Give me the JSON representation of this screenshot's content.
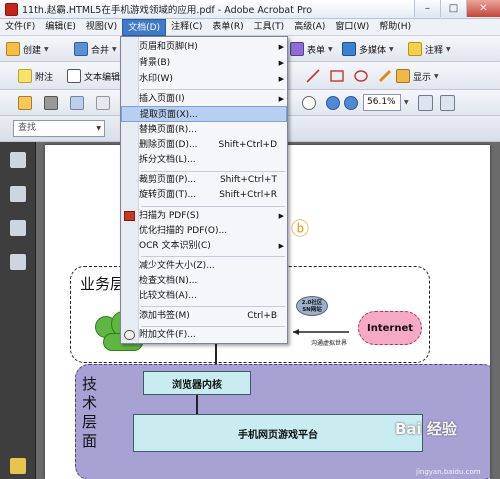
{
  "window": {
    "title": "11th.赵霸.HTML5在手机游戏领域的应用.pdf - Adobe Acrobat Pro",
    "minimize": "–",
    "maximize": "□",
    "close": "✕"
  },
  "menubar": [
    "文件(F)",
    "编辑(E)",
    "视图(V)",
    "文档(D)",
    "注释(C)",
    "表单(R)",
    "工具(T)",
    "高级(A)",
    "窗口(W)",
    "帮助(H)"
  ],
  "toolbar1": {
    "create": "创建",
    "combine": "合并",
    "forms": "表单",
    "multimedia": "多媒体",
    "comment": "注释"
  },
  "toolbar2": {
    "attach": "附注",
    "text_edit": "文本编辑",
    "display": "显示"
  },
  "toolbar3": {
    "zoom": "56.1%"
  },
  "toolbar4": {
    "find": "查找"
  },
  "document_menu": {
    "items": [
      {
        "label": "页眉和页脚(H)",
        "shortcut": "",
        "submenu": true
      },
      {
        "label": "背景(B)",
        "shortcut": "",
        "submenu": true
      },
      {
        "label": "水印(W)",
        "shortcut": "",
        "submenu": true
      },
      {
        "label": "插入页面(I)",
        "shortcut": "",
        "submenu": true
      },
      {
        "label": "提取页面(X)...",
        "shortcut": "",
        "submenu": false
      },
      {
        "label": "替换页面(R)...",
        "shortcut": "",
        "submenu": false
      },
      {
        "label": "删除页面(D)...",
        "shortcut": "Shift+Ctrl+D",
        "submenu": false
      },
      {
        "label": "拆分文档(L)...",
        "shortcut": "",
        "submenu": false
      },
      {
        "label": "裁剪页面(P)...",
        "shortcut": "Shift+Ctrl+T",
        "submenu": false
      },
      {
        "label": "旋转页面(T)...",
        "shortcut": "Shift+Ctrl+R",
        "submenu": false
      },
      {
        "label": "扫描为 PDF(S)",
        "shortcut": "",
        "submenu": true
      },
      {
        "label": "优化扫描的 PDF(O)...",
        "shortcut": "",
        "submenu": false
      },
      {
        "label": "OCR 文本识别(C)",
        "shortcut": "",
        "submenu": true
      },
      {
        "label": "减少文件大小(Z)...",
        "shortcut": "",
        "submenu": false
      },
      {
        "label": "检查文档(N)...",
        "shortcut": "",
        "submenu": false
      },
      {
        "label": "比较文档(A)...",
        "shortcut": "",
        "submenu": false
      },
      {
        "label": "添加书签(M)",
        "shortcut": "Ctrl+B",
        "submenu": false
      },
      {
        "label": "附加文件(F)...",
        "shortcut": "",
        "submenu": false
      }
    ]
  },
  "diagram": {
    "business_layer": "业务层",
    "tech_layer": "技术层面",
    "browser_core": "浏览器内核",
    "game_platform": "手机网页游戏平台",
    "internet": "Internet",
    "sns": "2.0社区 SN网站",
    "note": "沟通虚拟世界"
  },
  "watermark": {
    "main": "Bai 经验",
    "sub": "jingyan.baidu.com"
  }
}
